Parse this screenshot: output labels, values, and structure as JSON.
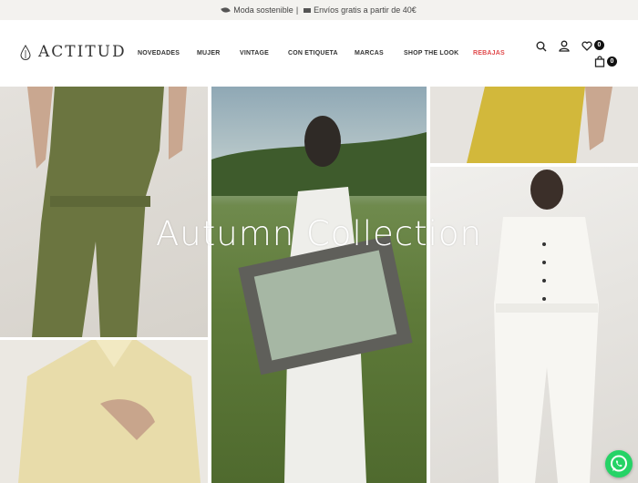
{
  "promo_bar": {
    "left_text": "Moda sostenible",
    "separator": "|",
    "right_text": "Envíos gratis a partir de 40€"
  },
  "brand": {
    "name": "ACTITUD"
  },
  "nav": {
    "items": [
      "NOVEDADES",
      "MUJER",
      "VINTAGE",
      "CON ETIQUETA",
      "MARCAS",
      "SHOP THE LOOK",
      "REBAJAS"
    ]
  },
  "header_icons": {
    "wishlist_count": "0",
    "cart_count": "0"
  },
  "hero": {
    "title": "Autumn Collection"
  },
  "colors": {
    "sale": "#e0494b",
    "whatsapp": "#25d366"
  }
}
